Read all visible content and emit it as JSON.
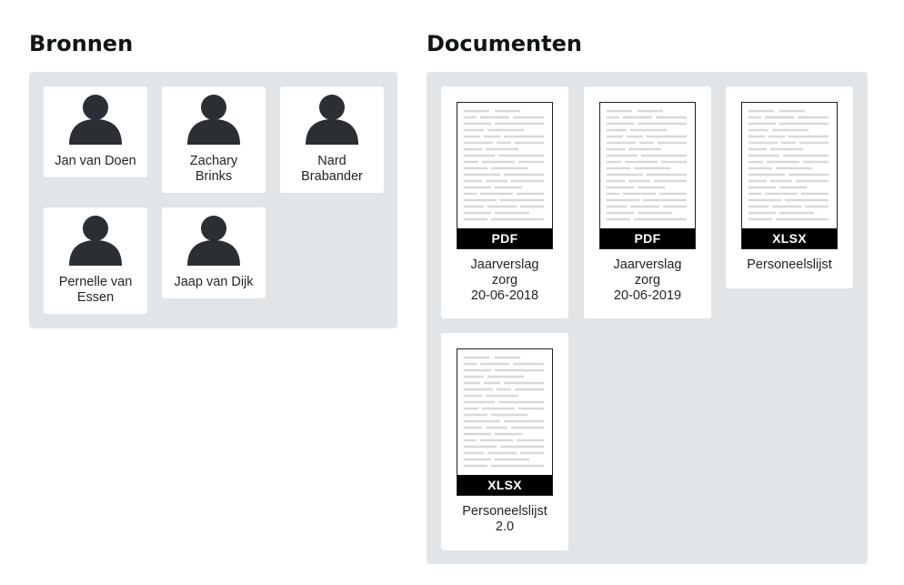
{
  "sources": {
    "title": "Bronnen",
    "people": [
      {
        "line1": "Jan van Doen",
        "line2": ""
      },
      {
        "line1": "Zachary",
        "line2": "Brinks"
      },
      {
        "line1": "Nard",
        "line2": "Brabander"
      },
      {
        "line1": "Pernelle van",
        "line2": "Essen"
      },
      {
        "line1": "Jaap van Dijk",
        "line2": ""
      }
    ]
  },
  "documents": {
    "title": "Documenten",
    "items": [
      {
        "type": "PDF",
        "lines": [
          "Jaarverslag",
          "zorg",
          "20-06-2018"
        ]
      },
      {
        "type": "PDF",
        "lines": [
          "Jaarverslag",
          "zorg",
          "20-06-2019"
        ]
      },
      {
        "type": "XLSX",
        "lines": [
          "Personeelslijst",
          "",
          ""
        ]
      },
      {
        "type": "XLSX",
        "lines": [
          "Personeelslijst",
          "2.0",
          ""
        ]
      }
    ]
  },
  "colors": {
    "panel": "#e2e5e8",
    "avatar": "#2b2f33",
    "badge": "#000000"
  }
}
